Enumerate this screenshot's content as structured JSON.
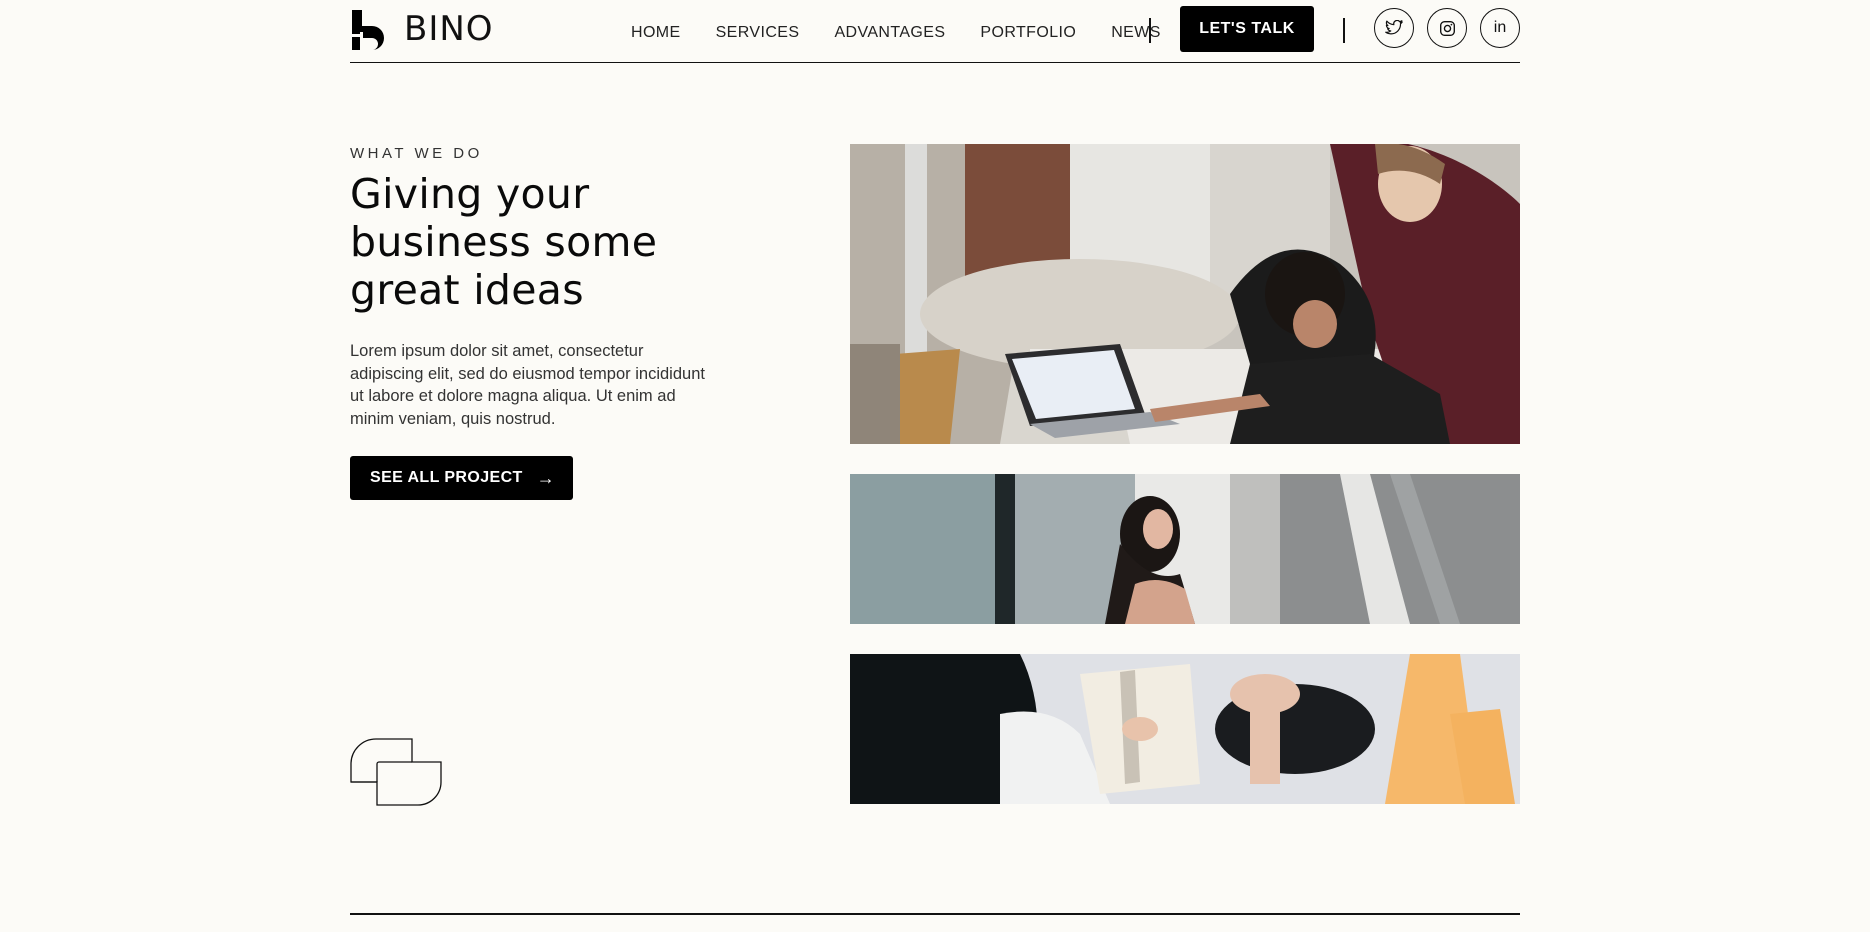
{
  "brand": {
    "name": "BINO"
  },
  "nav": {
    "items": [
      "HOME",
      "SERVICES",
      "ADVANTAGES",
      "PORTFOLIO",
      "NEWS"
    ],
    "cta_label": "LET'S TALK"
  },
  "social": [
    {
      "icon": "twitter-icon",
      "glyph": "🐦"
    },
    {
      "icon": "instagram-icon",
      "glyph": "◎"
    },
    {
      "icon": "linkedin-icon",
      "glyph": "in"
    }
  ],
  "hero": {
    "eyebrow": "WHAT WE DO",
    "headline": "Giving your business some great ideas",
    "body": "Lorem ipsum dolor sit amet, consectetur adipiscing elit, sed do eiusmod tempor incididunt ut labore et dolore magna aliqua. Ut enim ad minim veniam, quis nostrud.",
    "button_label": "SEE ALL PROJECT",
    "button_icon": "arrow-right-icon"
  },
  "colors": {
    "background": "#fcfbf7",
    "ink": "#000000",
    "accent_text": "#ffffff"
  }
}
